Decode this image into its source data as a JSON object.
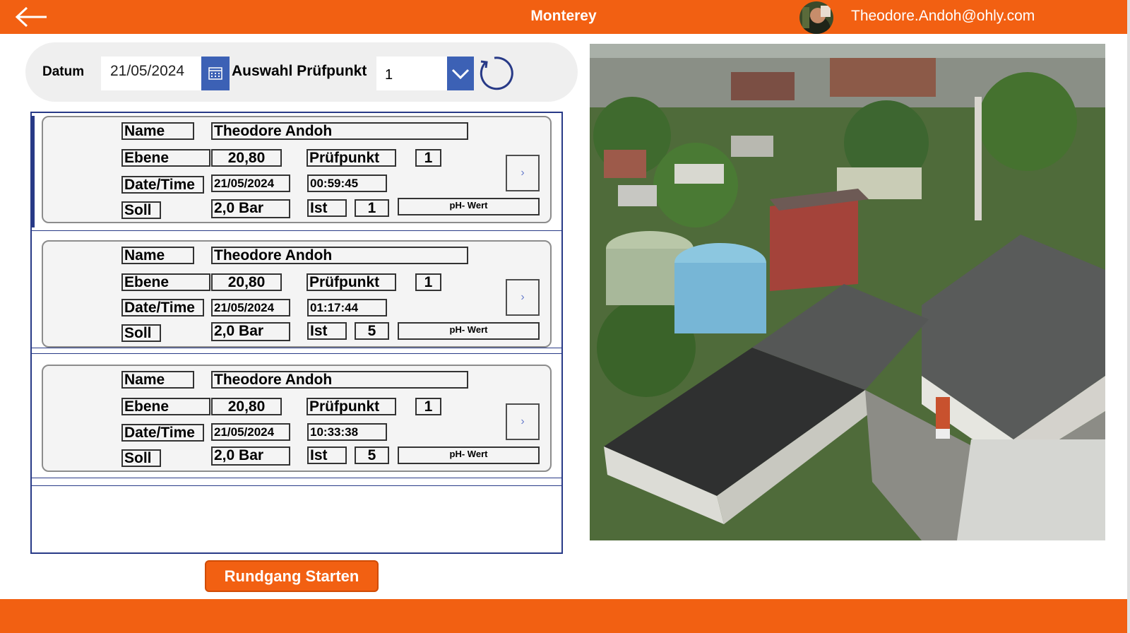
{
  "header": {
    "title": "Monterey",
    "user_email": "Theodore.Andoh@ohly.com"
  },
  "filter": {
    "datum_label": "Datum",
    "date_value": "21/05/2024",
    "auswahl_label": "Auswahl Prüfpunkt",
    "auswahl_value": "1"
  },
  "records": [
    {
      "name_label": "Name",
      "name": "Theodore Andoh",
      "ebene_label": "Ebene",
      "ebene": "20,80",
      "pruefpunkt_label": "Prüfpunkt",
      "pruefpunkt": "1",
      "datetime_label": "Date/Time",
      "date": "21/05/2024",
      "time": "00:59:45",
      "soll_label": "Soll",
      "soll": "2,0 Bar",
      "ist_label": "Ist",
      "ist": "1",
      "ph_label": "pH- Wert"
    },
    {
      "name_label": "Name",
      "name": "Theodore Andoh",
      "ebene_label": "Ebene",
      "ebene": "20,80",
      "pruefpunkt_label": "Prüfpunkt",
      "pruefpunkt": "1",
      "datetime_label": "Date/Time",
      "date": "21/05/2024",
      "time": "01:17:44",
      "soll_label": "Soll",
      "soll": "2,0 Bar",
      "ist_label": "Ist",
      "ist": "5",
      "ph_label": "pH- Wert"
    },
    {
      "name_label": "Name",
      "name": "Theodore Andoh",
      "ebene_label": "Ebene",
      "ebene": "20,80",
      "pruefpunkt_label": "Prüfpunkt",
      "pruefpunkt": "1",
      "datetime_label": "Date/Time",
      "date": "21/05/2024",
      "time": "10:33:38",
      "soll_label": "Soll",
      "soll": "2,0 Bar",
      "ist_label": "Ist",
      "ist": "5",
      "ph_label": "pH- Wert"
    }
  ],
  "actions": {
    "start_label": "Rundgang Starten"
  },
  "icons": {
    "back": "arrow-left-icon",
    "calendar": "calendar-icon",
    "dropdown": "chevron-down-icon",
    "refresh": "refresh-icon",
    "next": "chevron-right-icon"
  },
  "colors": {
    "brand_orange": "#f26012",
    "accent_blue": "#3c61b5",
    "gallery_border": "#283a87"
  }
}
